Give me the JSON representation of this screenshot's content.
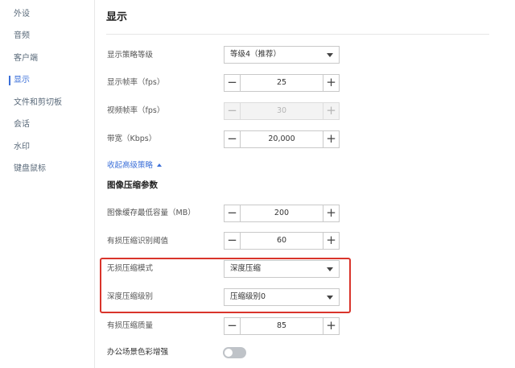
{
  "sidebar": {
    "items": [
      {
        "label": "外设",
        "active": false
      },
      {
        "label": "音频",
        "active": false
      },
      {
        "label": "客户端",
        "active": false
      },
      {
        "label": "显示",
        "active": true
      },
      {
        "label": "文件和剪切板",
        "active": false
      },
      {
        "label": "会话",
        "active": false
      },
      {
        "label": "水印",
        "active": false
      },
      {
        "label": "键盘鼠标",
        "active": false
      }
    ]
  },
  "main": {
    "title": "显示",
    "policy_level": {
      "label": "显示策略等级",
      "value": "等级4（推荐）"
    },
    "frame_rate": {
      "label": "显示帧率（fps）",
      "value": "25"
    },
    "video_frame_rate": {
      "label": "视频帧率（fps）",
      "value": "30",
      "disabled": true
    },
    "bandwidth": {
      "label": "带宽（Kbps）",
      "value": "20,000"
    },
    "collapse_link": "收起高级策略",
    "section_title": "图像压缩参数",
    "image_cache_min": {
      "label": "图像缓存最低容量（MB）",
      "value": "200"
    },
    "lossy_threshold": {
      "label": "有损压缩识别阈值",
      "value": "60"
    },
    "lossless_mode": {
      "label": "无损压缩模式",
      "value": "深度压缩"
    },
    "deep_level": {
      "label": "深度压缩级别",
      "value": "压缩级别0"
    },
    "lossy_quality": {
      "label": "有损压缩质量",
      "value": "85"
    },
    "office_color": {
      "label": "办公场景色彩增强",
      "enabled": false
    },
    "stepper_minus": "−",
    "stepper_plus": "+"
  },
  "colors": {
    "accent": "#3b6fd8",
    "highlight": "#d9342b",
    "toggle_off": "#bfc3c8"
  }
}
